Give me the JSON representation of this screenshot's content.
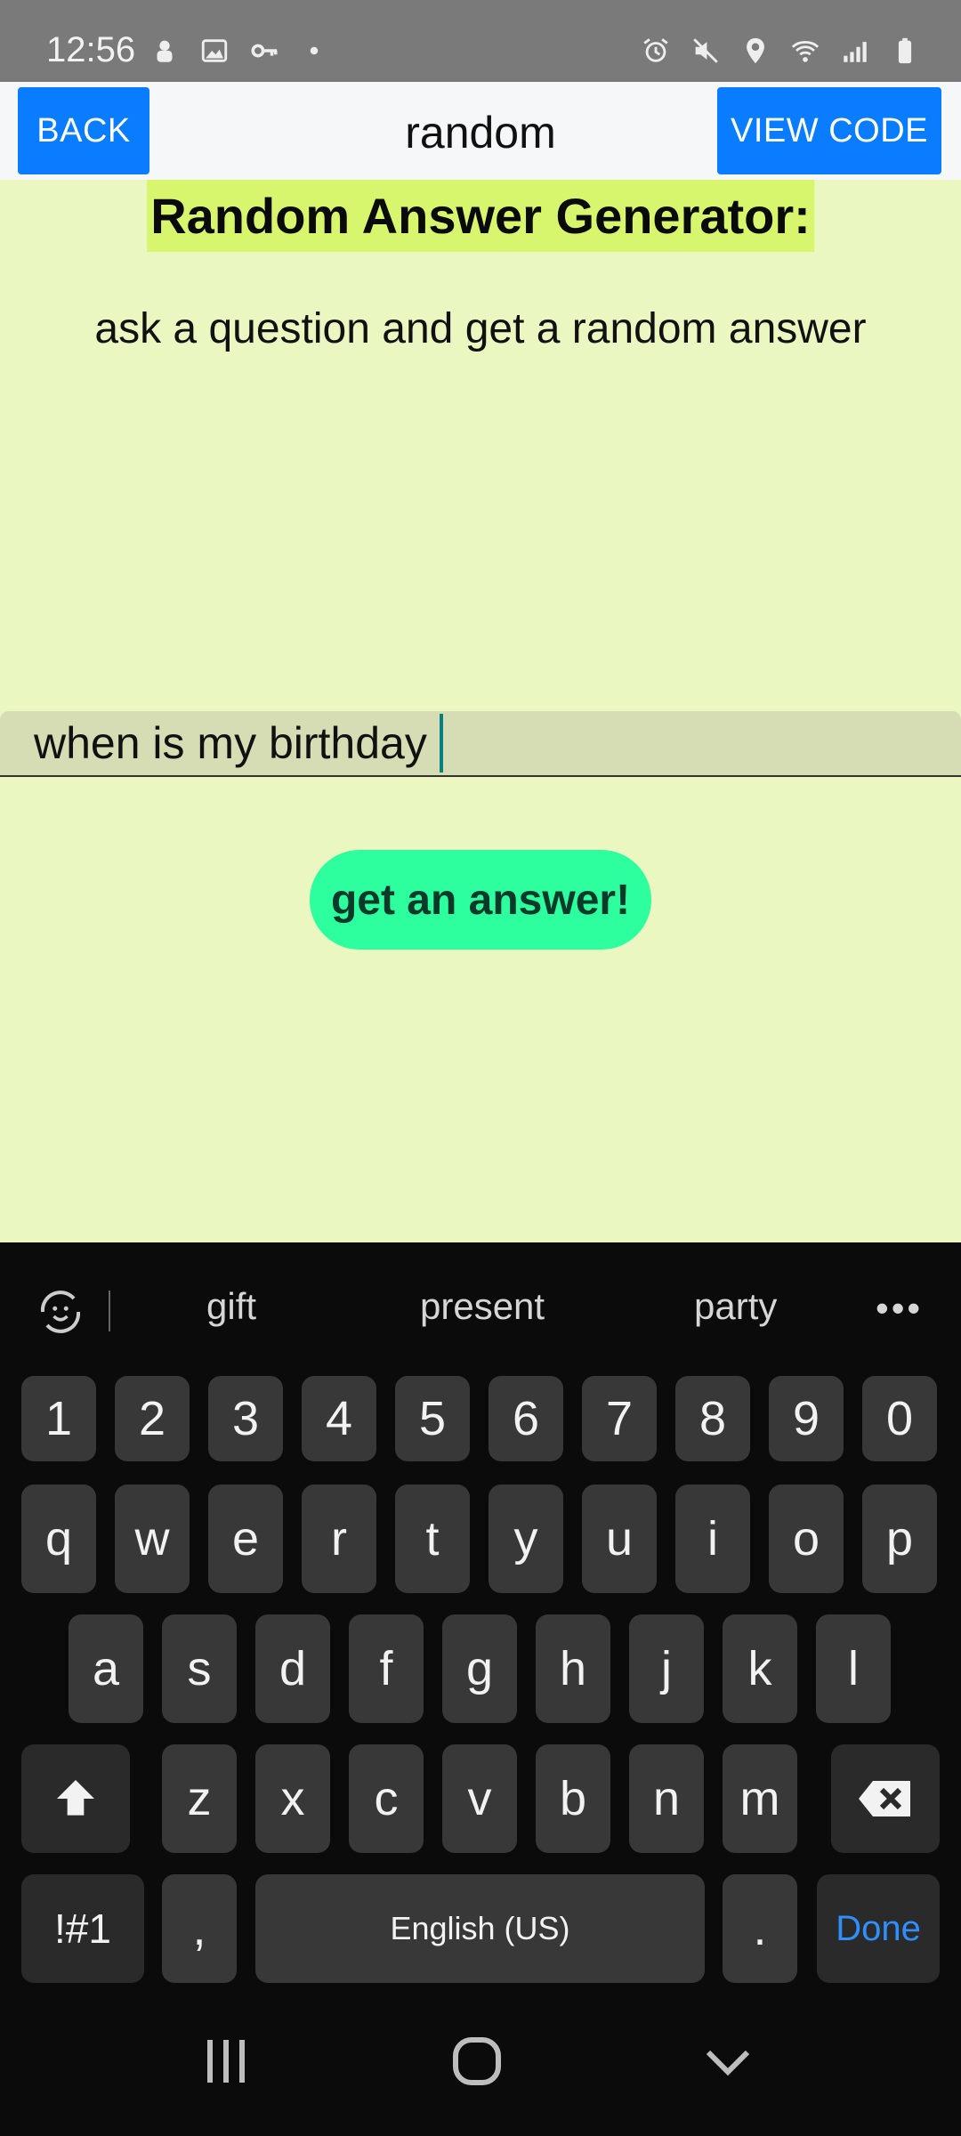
{
  "status_bar": {
    "time": "12:56",
    "left_icons": [
      "notification-icon",
      "image-icon",
      "key-icon",
      "dot-icon"
    ],
    "right_icons": [
      "alarm-icon",
      "mute-icon",
      "location-icon",
      "wifi-icon",
      "signal-icon",
      "battery-icon"
    ]
  },
  "header": {
    "back_label": "BACK",
    "title": "random",
    "view_code_label": "VIEW CODE",
    "accent": "#0a7cff"
  },
  "main": {
    "title": "Random Answer Generator:",
    "subtitle": "ask a question and get a random answer",
    "question_value": "when is my birthday",
    "answer_button_label": "get an answer!",
    "background": "#eaf7c1",
    "title_highlight": "#d8f56e",
    "button_color": "#2dff9e"
  },
  "keyboard": {
    "suggestions": [
      "gift",
      "present",
      "party"
    ],
    "more_label": "•••",
    "number_row": [
      "1",
      "2",
      "3",
      "4",
      "5",
      "6",
      "7",
      "8",
      "9",
      "0"
    ],
    "row1": [
      "q",
      "w",
      "e",
      "r",
      "t",
      "y",
      "u",
      "i",
      "o",
      "p"
    ],
    "row2": [
      "a",
      "s",
      "d",
      "f",
      "g",
      "h",
      "j",
      "k",
      "l"
    ],
    "row3": [
      "z",
      "x",
      "c",
      "v",
      "b",
      "n",
      "m"
    ],
    "symbols_label": "!#1",
    "comma_label": ",",
    "space_label": "English (US)",
    "period_label": ".",
    "done_label": "Done"
  }
}
